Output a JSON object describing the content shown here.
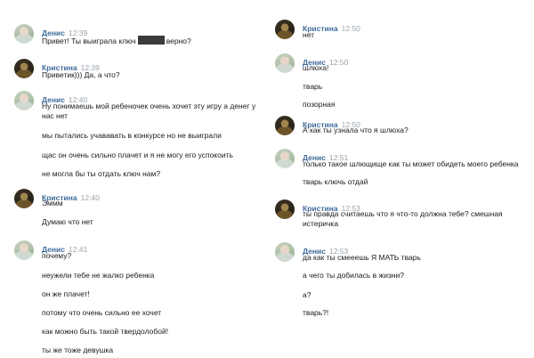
{
  "left": [
    {
      "author": "Денис",
      "time": "12:39",
      "avatar": "denis",
      "lines": [
        {
          "pre": "Привет! Ты выиграла ключ",
          "censored": true,
          "post": "верно?"
        }
      ]
    },
    {
      "author": "Кристина",
      "time": "12:39",
      "avatar": "kristina",
      "lines": [
        {
          "text": "Приветик))) Да, а что?"
        }
      ]
    },
    {
      "author": "Денис",
      "time": "12:40",
      "avatar": "denis",
      "lines": [
        {
          "text": "Ну понимаешь мой ребеночек очень хочет эту игру а денег у"
        },
        {
          "text": "нас нет"
        },
        {
          "text": "мы пытались учававать в конкурсе но не выиграли"
        },
        {
          "text": "щас он очень сильно плачет и я не могу его успокоить"
        },
        {
          "text": "не могла бы ты отдать ключ нам?"
        }
      ]
    },
    {
      "author": "Кристина",
      "time": "12:40",
      "avatar": "kristina",
      "lines": [
        {
          "text": "Эммм"
        },
        {
          "text": "Думаю что нет"
        }
      ]
    },
    {
      "author": "Денис",
      "time": "12:41",
      "avatar": "denis",
      "lines": [
        {
          "text": "почему?"
        },
        {
          "text": "неужели тебе не жалко ребенка"
        },
        {
          "text": "он же плачет!"
        },
        {
          "text": "потому что очень сильно ее хочет"
        },
        {
          "text": "как можно быть такой твердолобой!"
        },
        {
          "text": "ты же тоже девушка"
        }
      ]
    }
  ],
  "right": [
    {
      "author": "Кристина",
      "time": "12:50",
      "avatar": "kristina",
      "lines": [
        {
          "text": "нет"
        }
      ]
    },
    {
      "author": "Денис",
      "time": "12:50",
      "avatar": "denis",
      "lines": [
        {
          "text": "шлюха!"
        },
        {
          "text": "тварь"
        },
        {
          "text": "позорная"
        }
      ]
    },
    {
      "author": "Кристина",
      "time": "12:50",
      "avatar": "kristina",
      "lines": [
        {
          "text": "А как ты узнала что я шлюха?"
        }
      ]
    },
    {
      "author": "Денис",
      "time": "12:51",
      "avatar": "denis",
      "lines": [
        {
          "text": "только такое шлющище как ты может обидеть моего ребенка"
        },
        {
          "text": "тварь ключь отдай"
        }
      ]
    },
    {
      "author": "Кристина",
      "time": "12:53",
      "avatar": "kristina",
      "lines": [
        {
          "text": "ты правда считаешь что я что-то должна тебе? смешная"
        },
        {
          "text": "истеричка"
        }
      ]
    },
    {
      "author": "Денис",
      "time": "12:53",
      "avatar": "denis",
      "lines": [
        {
          "text": "да как ты смееешь Я МАТЬ тварь"
        },
        {
          "text": "а чего ты добилась в жизни?"
        },
        {
          "text": "а?"
        },
        {
          "text": "тварь?!"
        }
      ]
    }
  ]
}
